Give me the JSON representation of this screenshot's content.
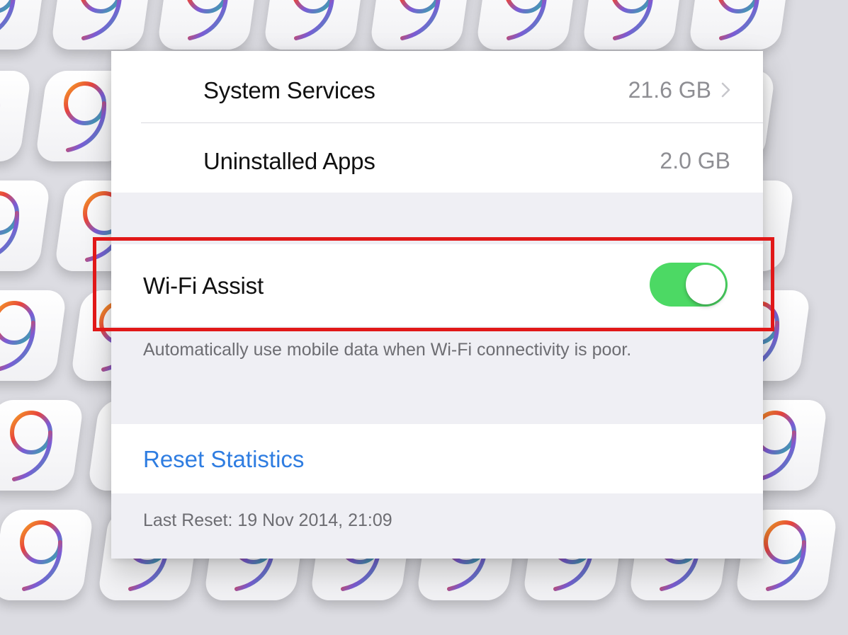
{
  "storage": {
    "rows": [
      {
        "label": "System Services",
        "value": "21.6 GB",
        "has_chevron": true
      },
      {
        "label": "Uninstalled Apps",
        "value": "2.0 GB",
        "has_chevron": false
      }
    ]
  },
  "wifi_assist": {
    "label": "Wi-Fi Assist",
    "enabled": true,
    "footer": "Automatically use mobile data when Wi-Fi connectivity is poor.",
    "toggle_color": "#4cd964"
  },
  "reset": {
    "label": "Reset Statistics",
    "last_reset": "Last Reset: 19 Nov 2014, 21:09",
    "link_color": "#2f7de1"
  },
  "highlight": {
    "color": "#e11818"
  },
  "background": {
    "tile_glyph": "9"
  }
}
